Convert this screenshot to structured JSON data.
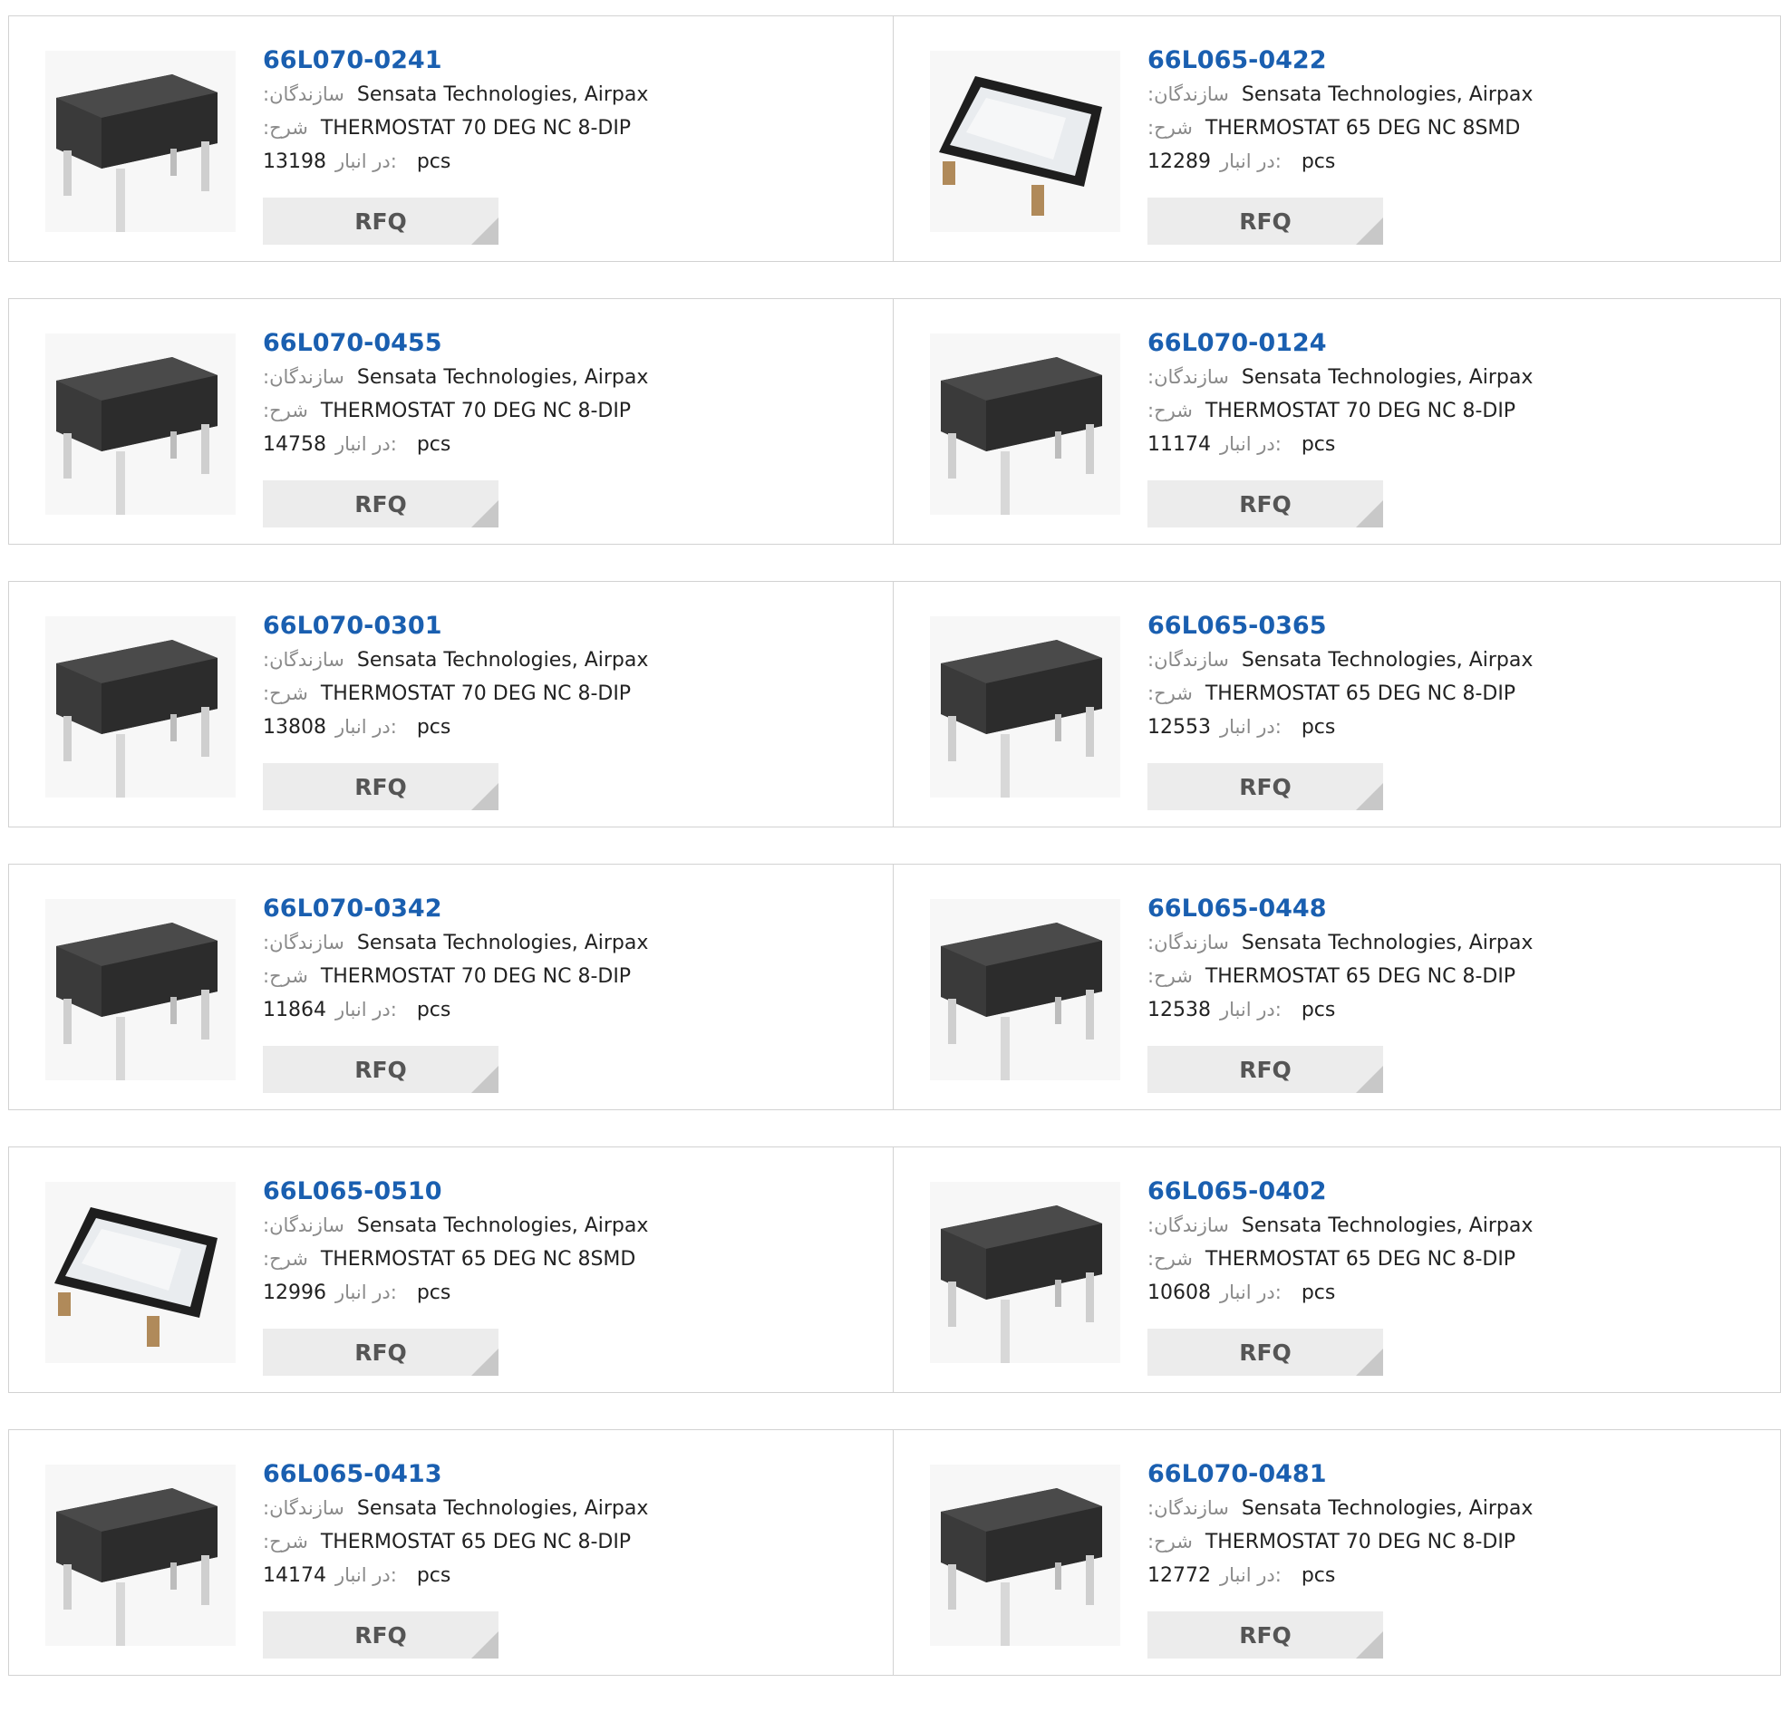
{
  "labels": {
    "manufacturer": ":سازندگان",
    "description": ":شرح",
    "stock": "در انبار:",
    "unit": "pcs",
    "rfq": "RFQ"
  },
  "colors": {
    "part_number": "#1a5fb0",
    "label": "#8a8a8a",
    "rfq_bg": "#ececec",
    "border": "#d2d2d2"
  },
  "products": [
    {
      "part": "66L070-0241",
      "manufacturer": "Sensata Technologies, Airpax",
      "description": "THERMOSTAT 70 DEG NC 8-DIP",
      "stock": "13198",
      "image": "dip-package"
    },
    {
      "part": "66L065-0422",
      "manufacturer": "Sensata Technologies, Airpax",
      "description": "THERMOSTAT 65 DEG NC 8SMD",
      "stock": "12289",
      "image": "smd-package"
    },
    {
      "part": "66L070-0455",
      "manufacturer": "Sensata Technologies, Airpax",
      "description": "THERMOSTAT 70 DEG NC 8-DIP",
      "stock": "14758",
      "image": "dip-package"
    },
    {
      "part": "66L070-0124",
      "manufacturer": "Sensata Technologies, Airpax",
      "description": "THERMOSTAT 70 DEG NC 8-DIP",
      "stock": "11174",
      "image": "dip-package"
    },
    {
      "part": "66L070-0301",
      "manufacturer": "Sensata Technologies, Airpax",
      "description": "THERMOSTAT 70 DEG NC 8-DIP",
      "stock": "13808",
      "image": "dip-package"
    },
    {
      "part": "66L065-0365",
      "manufacturer": "Sensata Technologies, Airpax",
      "description": "THERMOSTAT 65 DEG NC 8-DIP",
      "stock": "12553",
      "image": "dip-package"
    },
    {
      "part": "66L070-0342",
      "manufacturer": "Sensata Technologies, Airpax",
      "description": "THERMOSTAT 70 DEG NC 8-DIP",
      "stock": "11864",
      "image": "dip-package"
    },
    {
      "part": "66L065-0448",
      "manufacturer": "Sensata Technologies, Airpax",
      "description": "THERMOSTAT 65 DEG NC 8-DIP",
      "stock": "12538",
      "image": "dip-package"
    },
    {
      "part": "66L065-0510",
      "manufacturer": "Sensata Technologies, Airpax",
      "description": "THERMOSTAT 65 DEG NC 8SMD",
      "stock": "12996",
      "image": "smd-package"
    },
    {
      "part": "66L065-0402",
      "manufacturer": "Sensata Technologies, Airpax",
      "description": "THERMOSTAT 65 DEG NC 8-DIP",
      "stock": "10608",
      "image": "dip-package"
    },
    {
      "part": "66L065-0413",
      "manufacturer": "Sensata Technologies, Airpax",
      "description": "THERMOSTAT 65 DEG NC 8-DIP",
      "stock": "14174",
      "image": "dip-package"
    },
    {
      "part": "66L070-0481",
      "manufacturer": "Sensata Technologies, Airpax",
      "description": "THERMOSTAT 70 DEG NC 8-DIP",
      "stock": "12772",
      "image": "dip-package"
    }
  ]
}
